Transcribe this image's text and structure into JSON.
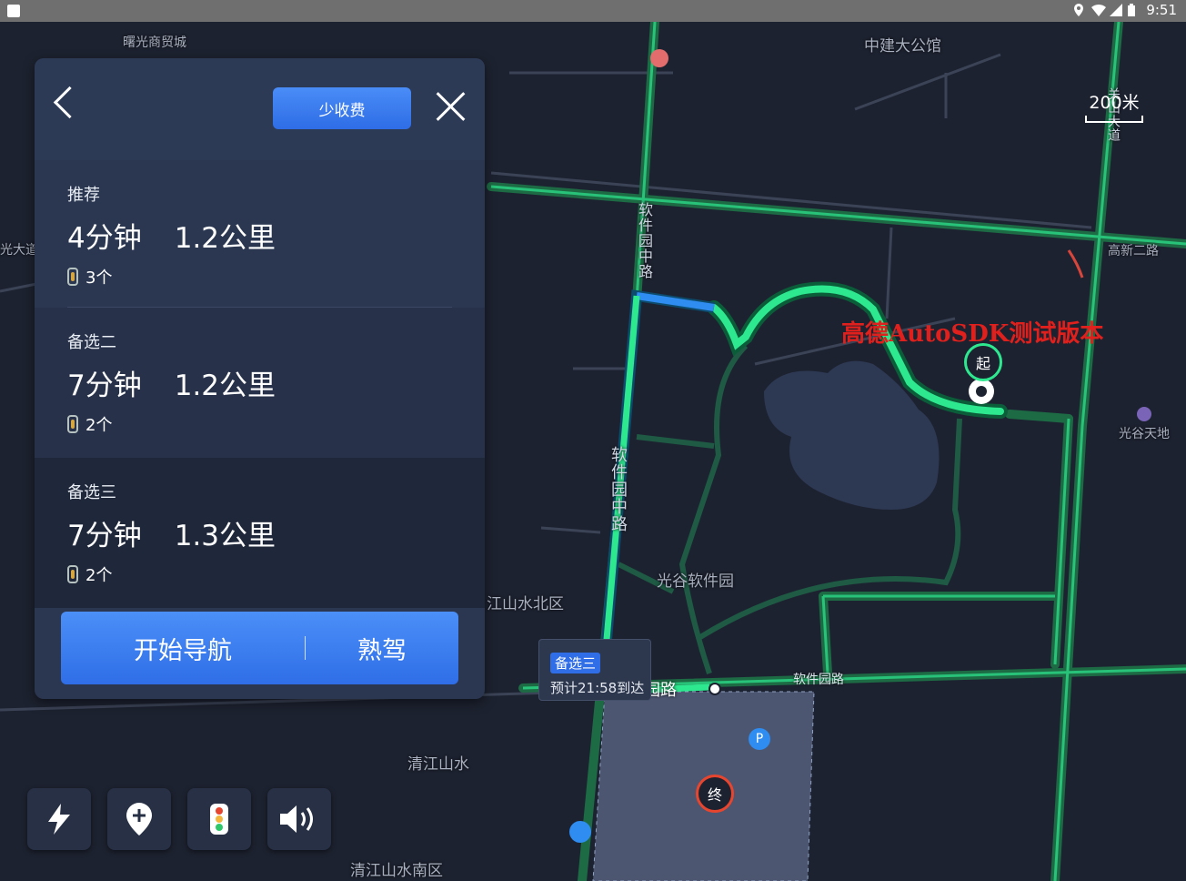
{
  "status_bar": {
    "time": "9:51"
  },
  "map": {
    "scale_label": "200米",
    "watermark": "高德AutoSDK测试版本",
    "labels": {
      "tl_poi": "曙光商贸城",
      "north_building": "中建大公馆",
      "left_road": "光大道",
      "ruanjian_zhonglu_upper": "软件园中路",
      "ruanjian_zhonglu_lower": "软件园中路",
      "gaoxin_er_lu": "高新二路",
      "guanggu_tiandi": "光谷天地",
      "guanggu_ruanjianyuan": "光谷软件园",
      "jiangshanshui_north": "江山水北区",
      "qingjiangshanshui": "清江山水",
      "qingjiangshanshui_south": "清江山水南区",
      "ruanjianyuan_lu_main": "软件园路",
      "ruanjianyuan_lu_east": "软件园路",
      "right_vertical_road": "关山大道"
    },
    "start_marker": "起",
    "end_marker": "终",
    "parking_icon": "P"
  },
  "panel": {
    "fee_button": "少收费",
    "routes": [
      {
        "tag": "推荐",
        "time": "4分钟",
        "distance": "1.2公里",
        "lights": "3个"
      },
      {
        "tag": "备选二",
        "time": "7分钟",
        "distance": "1.2公里",
        "lights": "2个"
      },
      {
        "tag": "备选三",
        "time": "7分钟",
        "distance": "1.3公里",
        "lights": "2个"
      }
    ],
    "start_nav": "开始导航",
    "familiar_drive": "熟驾"
  },
  "bubble": {
    "tag": "备选三",
    "eta": "预计21:58到达"
  },
  "colors": {
    "route_green": "#2ee88f",
    "route_blue": "#2f8cf0",
    "button_blue": "#3a7cf0",
    "end_red": "#e8452f"
  }
}
